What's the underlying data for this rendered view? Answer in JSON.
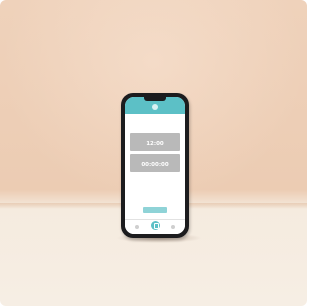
{
  "screen": {
    "intro_text": "",
    "card_title": "",
    "panels": [
      {
        "label": "",
        "value": "12:00"
      },
      {
        "label": "",
        "value": "00:00:00"
      }
    ],
    "notes_text": "",
    "cta_label": ""
  },
  "colors": {
    "accent": "#5cc0c6",
    "panel": "#b9b9b9",
    "wall": "#efd2bb",
    "floor": "#f6eee4"
  },
  "icons": [
    "app-logo-icon",
    "home-icon",
    "center-action-icon",
    "settings-icon"
  ]
}
